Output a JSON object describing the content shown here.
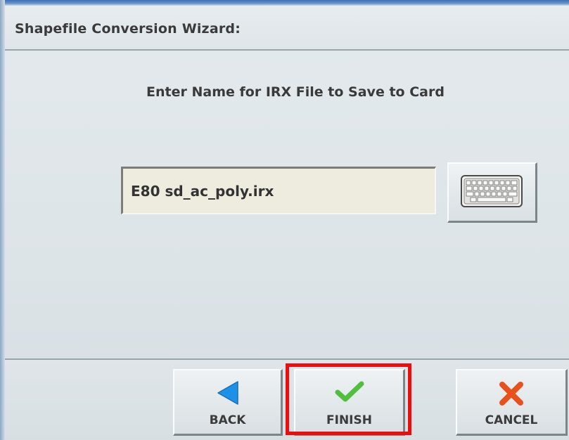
{
  "wizard": {
    "title": "Shapefile Conversion Wizard:",
    "prompt": "Enter Name for IRX File to Save to Card"
  },
  "file_name": {
    "value": "E80 sd_ac_poly.irx",
    "placeholder": ""
  },
  "keyboard_button": {
    "icon": "keyboard-icon"
  },
  "nav": {
    "back": {
      "label": "BACK",
      "icon": "back-arrow-icon",
      "color": "#1e90e8"
    },
    "finish": {
      "label": "FINISH",
      "icon": "checkmark-icon",
      "color": "#4fbf3c"
    },
    "cancel": {
      "label": "CANCEL",
      "icon": "x-icon",
      "color": "#e8501c"
    }
  },
  "colors": {
    "background": "#dfe6ea",
    "input_background": "#eeebdf",
    "highlight": "#ee0c0c"
  }
}
